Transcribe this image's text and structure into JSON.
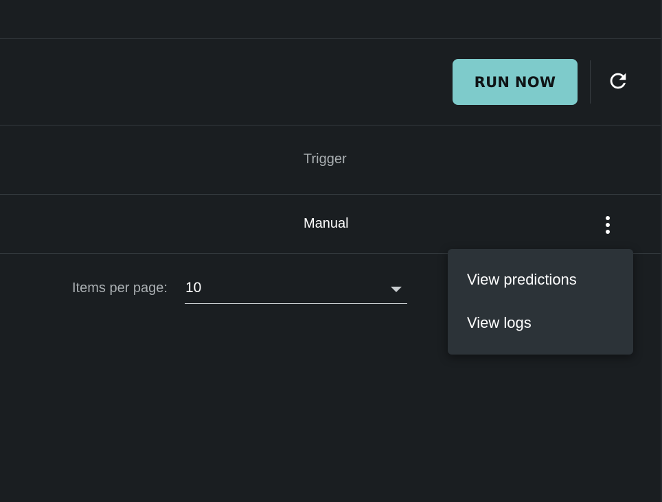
{
  "toolbar": {
    "run_now_label": "RUN NOW",
    "refresh_icon": "refresh-icon",
    "accent_color": "#7ecbcb"
  },
  "table": {
    "columns": [
      {
        "label": "Trigger"
      }
    ],
    "rows": [
      {
        "trigger": "Manual",
        "actions_icon": "more-vert-icon"
      }
    ]
  },
  "pagination": {
    "items_per_page_label": "Items per page:",
    "items_per_page_value": "10"
  },
  "row_menu": {
    "items": [
      {
        "label": "View predictions"
      },
      {
        "label": "View logs"
      }
    ]
  }
}
